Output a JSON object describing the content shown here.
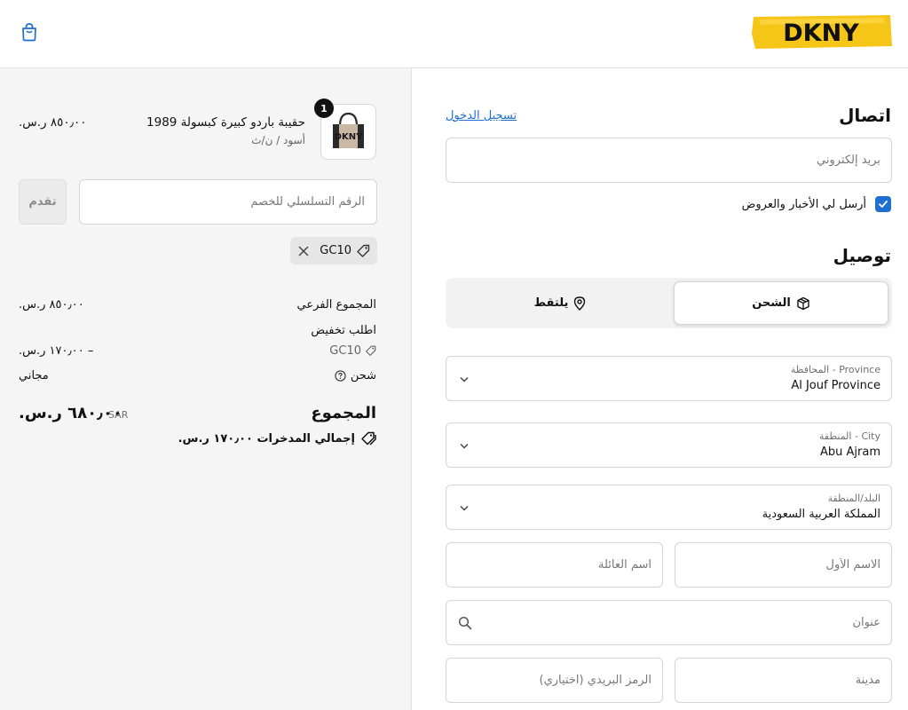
{
  "header": {
    "logo_text": "DKNY",
    "brand_color": "#f5c518"
  },
  "summary": {
    "item": {
      "quantity": "1",
      "name": "حقيبة باردو كبيرة كبسولة 1989",
      "variant": "أسود / ن/ث",
      "price": "٨٥٠٫٠٠ ر.س.",
      "thumb_text": "DKNY"
    },
    "discount": {
      "placeholder": "الرقم التسلسلي للخصم",
      "apply_label": "تقدم",
      "applied_code": "GC10"
    },
    "rows": {
      "subtotal_label": "المجموع الفرعي",
      "subtotal_value": "٨٥٠٫٠٠ ر.س.",
      "discount_label": "اطلب تخفيض",
      "discount_code": "GC10",
      "discount_value": "– ١٧٠٫٠٠ ر.س.",
      "shipping_label": "شحن",
      "shipping_value": "مجاني"
    },
    "total": {
      "label": "المجموع",
      "currency": "SAR",
      "value": "٦٨٠٫٠٠ ر.س.",
      "savings": "إجمالي المدخرات ١٧٠٫٠٠ ر.س."
    }
  },
  "form": {
    "contact_title": "اتصال",
    "login_link": "تسجيل الدخول",
    "email_placeholder": "بريد إلكتروني",
    "newsletter_label": "أرسل لي الأخبار والعروض",
    "newsletter_checked": true,
    "delivery_title": "توصيل",
    "delivery_options": {
      "ship": "الشحن",
      "pickup": "يلتقط"
    },
    "province": {
      "label": "Province - المحافظة",
      "value": "Al Jouf Province"
    },
    "city_select": {
      "label": "City - المنطقة",
      "value": "Abu Ajram"
    },
    "country": {
      "label": "البلد/المنطقة",
      "value": "المملكة العربية السعودية"
    },
    "first_name_placeholder": "الاسم الأول",
    "last_name_placeholder": "اسم العائلة",
    "address_placeholder": "عنوان",
    "city_placeholder": "مدينة",
    "postal_placeholder": "الرمز البريدي (اختياري)",
    "accent_color": "#1f6fd1"
  }
}
